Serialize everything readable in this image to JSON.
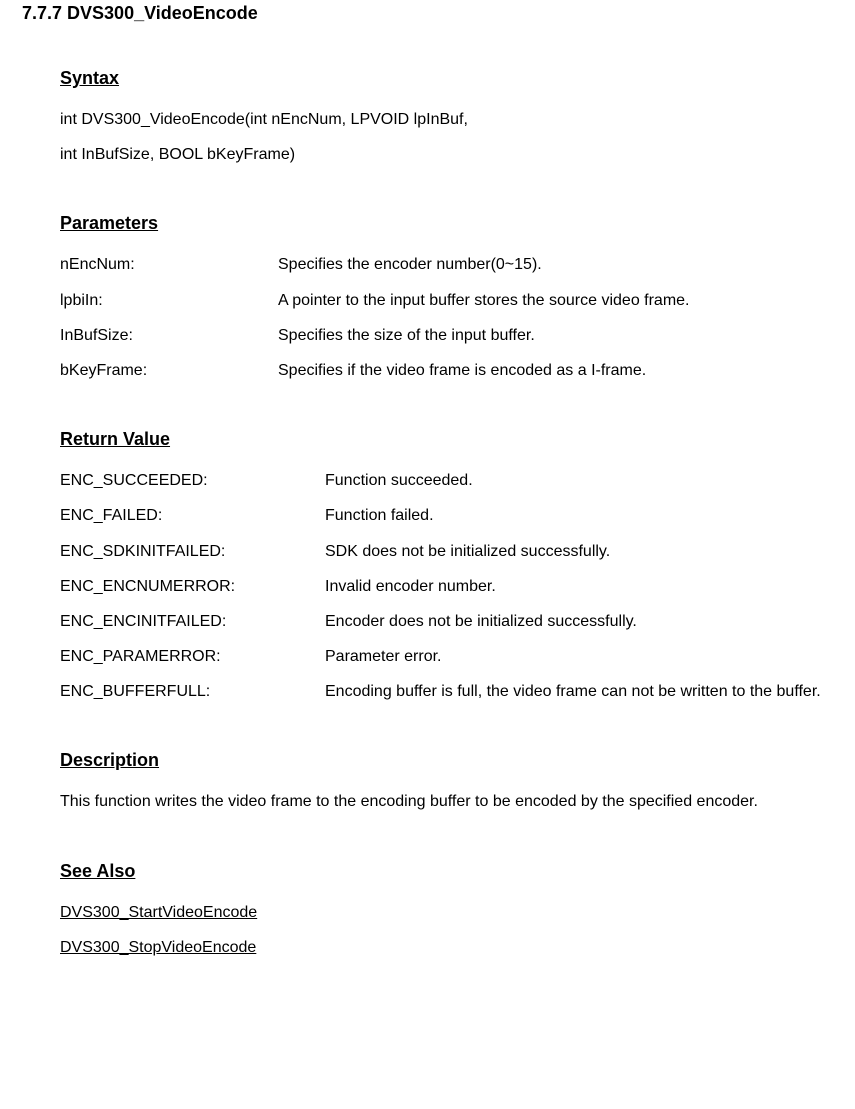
{
  "section": {
    "number_title": "7.7.7 DVS300_VideoEncode"
  },
  "syntax": {
    "heading": "Syntax",
    "line1": "int DVS300_VideoEncode(int nEncNum, LPVOID lpInBuf,",
    "line2": "int InBufSize, BOOL bKeyFrame)"
  },
  "parameters": {
    "heading": "Parameters",
    "items": [
      {
        "name": "nEncNum:",
        "desc": "Specifies the encoder number(0~15)."
      },
      {
        "name": "lpbiIn:",
        "desc": "A pointer to the input buffer stores the source video frame."
      },
      {
        "name": "InBufSize:",
        "desc": "Specifies the size of the input buffer."
      },
      {
        "name": "bKeyFrame:",
        "desc": "Specifies if the video frame is encoded as a I-frame."
      }
    ]
  },
  "return_value": {
    "heading": "Return Value",
    "items": [
      {
        "name": "ENC_SUCCEEDED:",
        "desc": "Function succeeded."
      },
      {
        "name": "ENC_FAILED:",
        "desc": "Function failed."
      },
      {
        "name": "ENC_SDKINITFAILED:",
        "desc": "SDK does not be initialized successfully."
      },
      {
        "name": "ENC_ENCNUMERROR:",
        "desc": "Invalid encoder number."
      },
      {
        "name": "ENC_ENCINITFAILED:",
        "desc": "Encoder does not be initialized successfully."
      },
      {
        "name": "ENC_PARAMERROR:",
        "desc": "Parameter error."
      },
      {
        "name": "ENC_BUFFERFULL:",
        "desc": "Encoding buffer is full, the video frame can not be written to the buffer."
      }
    ]
  },
  "description": {
    "heading": "Description",
    "text": "This function writes the video frame to the encoding buffer to be encoded by the specified encoder."
  },
  "see_also": {
    "heading": "See Also",
    "links": [
      "DVS300_StartVideoEncode",
      "DVS300_StopVideoEncode"
    ]
  }
}
